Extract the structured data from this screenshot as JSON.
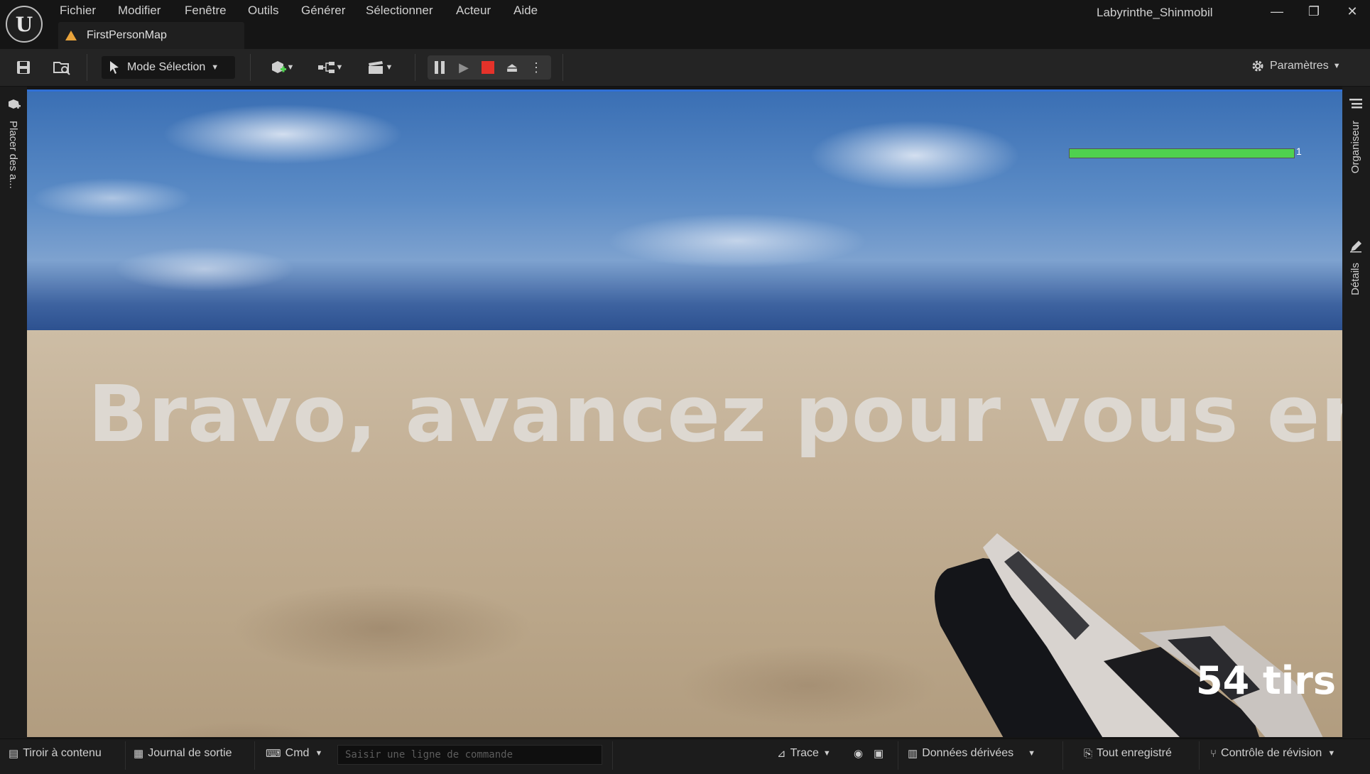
{
  "menu": {
    "items": [
      "Fichier",
      "Modifier",
      "Fenêtre",
      "Outils",
      "Générer",
      "Sélectionner",
      "Acteur",
      "Aide"
    ]
  },
  "window": {
    "title": "Labyrinthe_Shinmobil",
    "minimize": "—",
    "restore": "❐",
    "close": "✕"
  },
  "tab": {
    "label": "FirstPersonMap"
  },
  "toolbar": {
    "mode_label": "Mode Sélection",
    "settings_label": "Paramètres"
  },
  "left_panel": {
    "label": "Placer des a..."
  },
  "right_panel": {
    "organizer_label": "Organiseur",
    "details_label": "Détails"
  },
  "game": {
    "health": {
      "fill_fraction": 1.0,
      "value": "1",
      "color": "#4fd14f"
    },
    "message": "Bravo, avancez pour vous enfuir",
    "shots": "54 tirs"
  },
  "statusbar": {
    "content_drawer": "Tiroir à contenu",
    "output_log": "Journal de sortie",
    "cmd_label": "Cmd",
    "cmd_placeholder": "Saisir une ligne de commande",
    "trace_label": "Trace",
    "derived_data": "Données dérivées",
    "save_status": "Tout enregistré",
    "revision_control": "Contrôle de révision"
  },
  "colors": {
    "accent_border": "#2f6fd6",
    "stop_red": "#e5322a",
    "tab_icon": "#e8a33b"
  }
}
